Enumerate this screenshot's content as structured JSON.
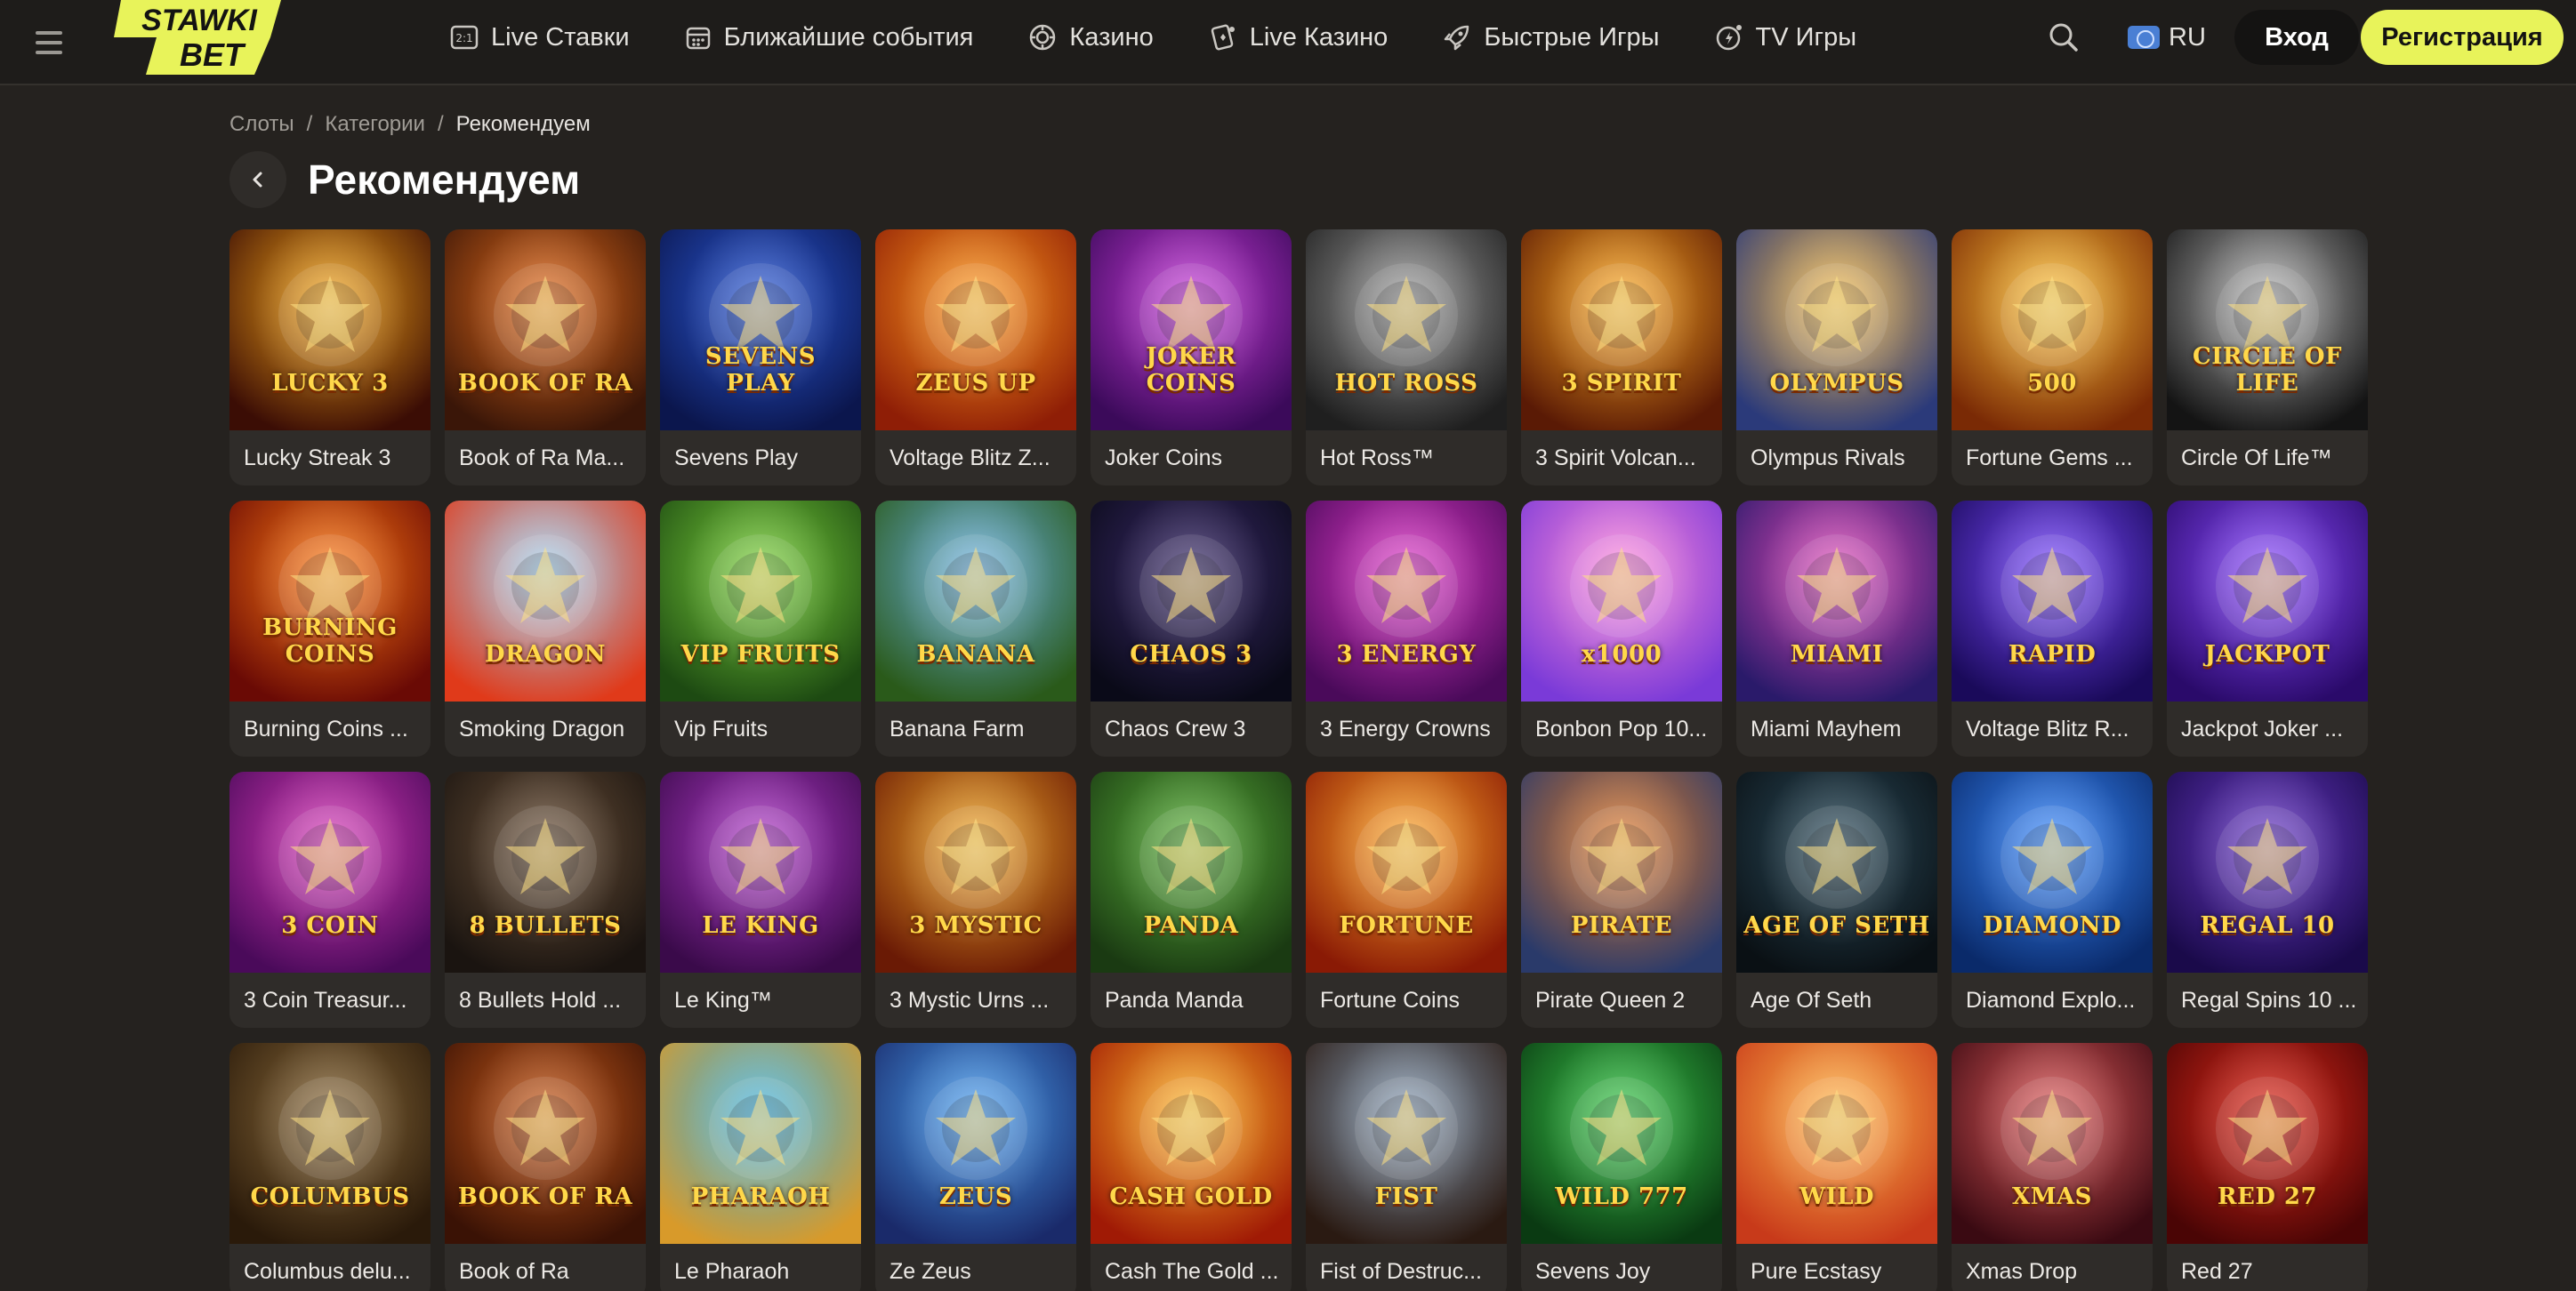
{
  "header": {
    "logo_line1": "STAWKI",
    "logo_line2": "BET",
    "nav": [
      {
        "label": "Live Ставки",
        "icon": "live-bets-icon"
      },
      {
        "label": "Ближайшие события",
        "icon": "calendar-icon"
      },
      {
        "label": "Казино",
        "icon": "casino-chip-icon"
      },
      {
        "label": "Live Казино",
        "icon": "live-casino-card-icon"
      },
      {
        "label": "Быстрые Игры",
        "icon": "rocket-icon"
      },
      {
        "label": "TV Игры",
        "icon": "tv-games-icon"
      }
    ],
    "language": "RU",
    "login_label": "Вход",
    "register_label": "Регистрация",
    "accent": "#e8f35a"
  },
  "breadcrumb": {
    "items": [
      "Слоты",
      "Категории"
    ],
    "current": "Рекомендуем",
    "separator": "/"
  },
  "page_title": "Рекомендуем",
  "games": [
    {
      "title": "Lucky Streak 3",
      "art": "LUCKY 3",
      "c1": "#f3a418",
      "c2": "#3b0d05"
    },
    {
      "title": "Book of Ra Ma...",
      "art": "BOOK OF RA",
      "c1": "#e26a1a",
      "c2": "#3a1608"
    },
    {
      "title": "Sevens Play",
      "art": "SEVENS PLAY",
      "c1": "#2a58d6",
      "c2": "#0b164d"
    },
    {
      "title": "Voltage Blitz Z...",
      "art": "ZEUS UP",
      "c1": "#ff9a1e",
      "c2": "#8f1e06"
    },
    {
      "title": "Joker Coins",
      "art": "JOKER COINS",
      "c1": "#c63ad8",
      "c2": "#3b0a5a"
    },
    {
      "title": "Hot Ross™",
      "art": "HOT ROSS",
      "c1": "#9a9a9a",
      "c2": "#1f1f1f"
    },
    {
      "title": "3 Spirit Volcan...",
      "art": "3 SPIRIT",
      "c1": "#ffaa22",
      "c2": "#5a1a05"
    },
    {
      "title": "Olympus Rivals",
      "art": "OLYMPUS",
      "c1": "#f2b94a",
      "c2": "#2b3a7a"
    },
    {
      "title": "Fortune Gems ...",
      "art": "500",
      "c1": "#ffc43a",
      "c2": "#7a2a05"
    },
    {
      "title": "Circle Of Life™",
      "art": "CIRCLE OF LIFE",
      "c1": "#b5b5b5",
      "c2": "#141414"
    },
    {
      "title": "Burning Coins ...",
      "art": "BURNING COINS",
      "c1": "#ff7a12",
      "c2": "#6a0a05"
    },
    {
      "title": "Smoking Dragon",
      "art": "DRAGON",
      "c1": "#9ed0f0",
      "c2": "#e03a1a"
    },
    {
      "title": "Vip Fruits",
      "art": "VIP FRUITS",
      "c1": "#7ad03a",
      "c2": "#1d4a12"
    },
    {
      "title": "Banana Farm",
      "art": "BANANA",
      "c1": "#6ab0e0",
      "c2": "#2a5a1a"
    },
    {
      "title": "Chaos Crew 3",
      "art": "CHAOS 3",
      "c1": "#3a2a6a",
      "c2": "#0a0a18"
    },
    {
      "title": "3 Energy Crowns",
      "art": "3 ENERGY",
      "c1": "#e03ac8",
      "c2": "#4a0a5a"
    },
    {
      "title": "Bonbon Pop 10...",
      "art": "x1000",
      "c1": "#ff8ad8",
      "c2": "#7a3ad8"
    },
    {
      "title": "Miami Mayhem",
      "art": "MIAMI",
      "c1": "#e04ab8",
      "c2": "#2a1a6a"
    },
    {
      "title": "Voltage Blitz R...",
      "art": "RAPID",
      "c1": "#7a4aff",
      "c2": "#1a0a5a"
    },
    {
      "title": "Jackpot Joker ...",
      "art": "JACKPOT",
      "c1": "#8a4aff",
      "c2": "#2a0a6a"
    },
    {
      "title": "3 Coin Treasur...",
      "art": "3 COIN",
      "c1": "#d83ab8",
      "c2": "#4a0a5a"
    },
    {
      "title": "8 Bullets Hold ...",
      "art": "8 BULLETS",
      "c1": "#6a5038",
      "c2": "#1a1410"
    },
    {
      "title": "Le King™",
      "art": "LE KING",
      "c1": "#b03ac8",
      "c2": "#3a0a4a"
    },
    {
      "title": "3 Mystic Urns ...",
      "art": "3 MYSTIC",
      "c1": "#f0a82a",
      "c2": "#6a1a05"
    },
    {
      "title": "Panda Manda",
      "art": "PANDA",
      "c1": "#5ab03a",
      "c2": "#1a3a12"
    },
    {
      "title": "Fortune Coins",
      "art": "FORTUNE",
      "c1": "#ffa82a",
      "c2": "#8a1a05"
    },
    {
      "title": "Pirate Queen 2",
      "art": "PIRATE",
      "c1": "#e07a2a",
      "c2": "#2a3a6a"
    },
    {
      "title": "Age Of Seth",
      "art": "AGE OF SETH",
      "c1": "#2a4a5a",
      "c2": "#0a1014"
    },
    {
      "title": "Diamond Explo...",
      "art": "DIAMOND",
      "c1": "#3a8aff",
      "c2": "#0a2a6a"
    },
    {
      "title": "Regal Spins 10 ...",
      "art": "REGAL 10",
      "c1": "#6a3ac8",
      "c2": "#1a0a4a"
    },
    {
      "title": "Columbus delu...",
      "art": "COLUMBUS",
      "c1": "#8a6a3a",
      "c2": "#2a1a0a"
    },
    {
      "title": "Book of Ra",
      "art": "BOOK OF RA",
      "c1": "#c85a1a",
      "c2": "#3a1205"
    },
    {
      "title": "Le Pharaoh",
      "art": "PHARAOH",
      "c1": "#3ab0e0",
      "c2": "#d89a2a"
    },
    {
      "title": "Ze Zeus",
      "art": "ZEUS",
      "c1": "#4aa0f0",
      "c2": "#1a2a6a"
    },
    {
      "title": "Cash The Gold ...",
      "art": "CASH GOLD",
      "c1": "#ffb82a",
      "c2": "#a01a05"
    },
    {
      "title": "Fist of Destruc...",
      "art": "FIST",
      "c1": "#8aa0b8",
      "c2": "#2a1a12"
    },
    {
      "title": "Sevens Joy",
      "art": "WILD 777",
      "c1": "#3ac84a",
      "c2": "#0a3a12"
    },
    {
      "title": "Pure Ecstasy",
      "art": "WILD",
      "c1": "#ffb84a",
      "c2": "#c83a1a"
    },
    {
      "title": "Xmas Drop",
      "art": "XMAS",
      "c1": "#e05a5a",
      "c2": "#3a0a12"
    },
    {
      "title": "Red 27",
      "art": "RED 27",
      "c1": "#e0281a",
      "c2": "#4a0505"
    }
  ]
}
